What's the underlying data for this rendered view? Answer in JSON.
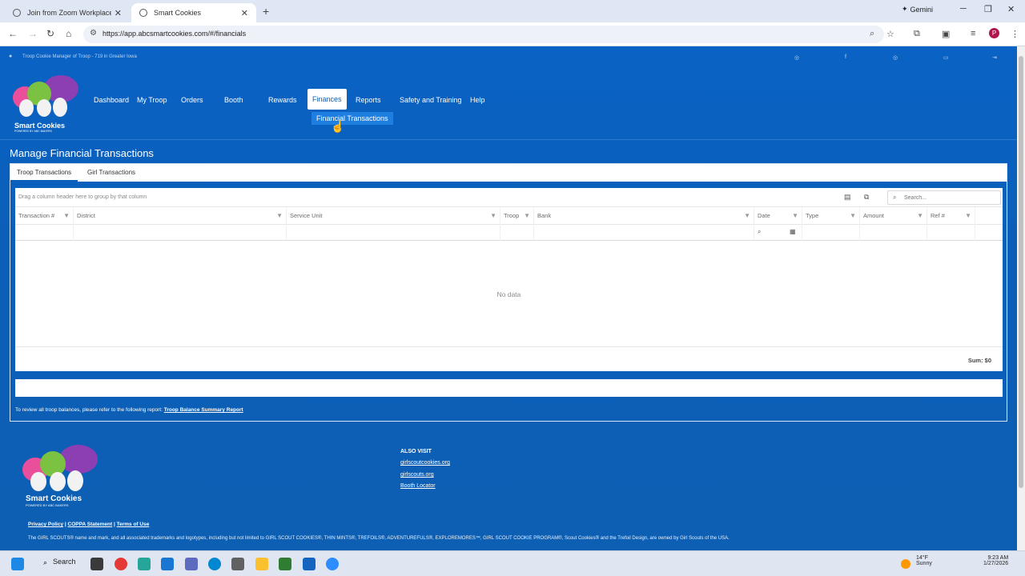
{
  "browser": {
    "tabs": [
      {
        "title": "Join from Zoom Workplace app",
        "active": false
      },
      {
        "title": "Smart Cookies",
        "active": true
      }
    ],
    "new_tab_icon": "plus-icon",
    "gemini_label": "Gemini",
    "url": "https://app.abcsmartcookies.com/#/financials",
    "profile_initial": "P"
  },
  "header": {
    "user_info": "Troop Cookie Manager of Troop - 719 in Greater Iowa",
    "logo_text": "Smart Cookies",
    "logo_tagline": "POWERED BY ABC BAKERS"
  },
  "nav": {
    "items": [
      "Dashboard",
      "My Troop",
      "Orders",
      "Booth",
      "Rewards",
      "Finances",
      "Reports",
      "Safety and Training",
      "Help"
    ],
    "active": "Finances",
    "submenu": "Financial Transactions"
  },
  "main": {
    "title": "Manage Financial Transactions",
    "tabs": [
      "Troop Transactions",
      "Girl Transactions"
    ],
    "group_hint": "Drag a column header here to group by that column",
    "search_placeholder": "Search...",
    "columns": [
      "Transaction #",
      "District",
      "Service Unit",
      "Troop",
      "Bank",
      "Date",
      "Type",
      "Amount",
      "Ref #"
    ],
    "empty_text": "No data",
    "sum": "Sum: $0",
    "note_text": "To review all troop balances, please refer to the following report:",
    "note_link": "Troop Balance Summary Report"
  },
  "footer": {
    "also_visit": "ALSO VISIT",
    "links": [
      "girlscoutcookies.org",
      "girlscouts.org",
      "Booth Locator"
    ],
    "privacy": "Privacy Policy",
    "coppa": "COPPA Statement",
    "terms": "Terms of Use",
    "separator": "|",
    "trademark": "The GIRL SCOUTS® name and mark, and all associated trademarks and logotypes, including but not limited to GIRL SCOUT COOKIES®, THIN MINTS®, TREFOILS®, ADVENTUREFULS®, EXPLOREMORES™, GIRL SCOUT COOKIE PROGRAM®, Scout Cookies® and the Trefoil Design, are owned by Girl Scouts of the USA."
  },
  "taskbar": {
    "search_label": "Search",
    "weather_temp": "14°F",
    "weather_desc": "Sunny",
    "time": "9:23 AM",
    "date": "1/27/2026"
  },
  "colors": {
    "page_blue": "#0b5fb8",
    "submenu_blue": "#1f7fe0",
    "white": "#ffffff"
  }
}
